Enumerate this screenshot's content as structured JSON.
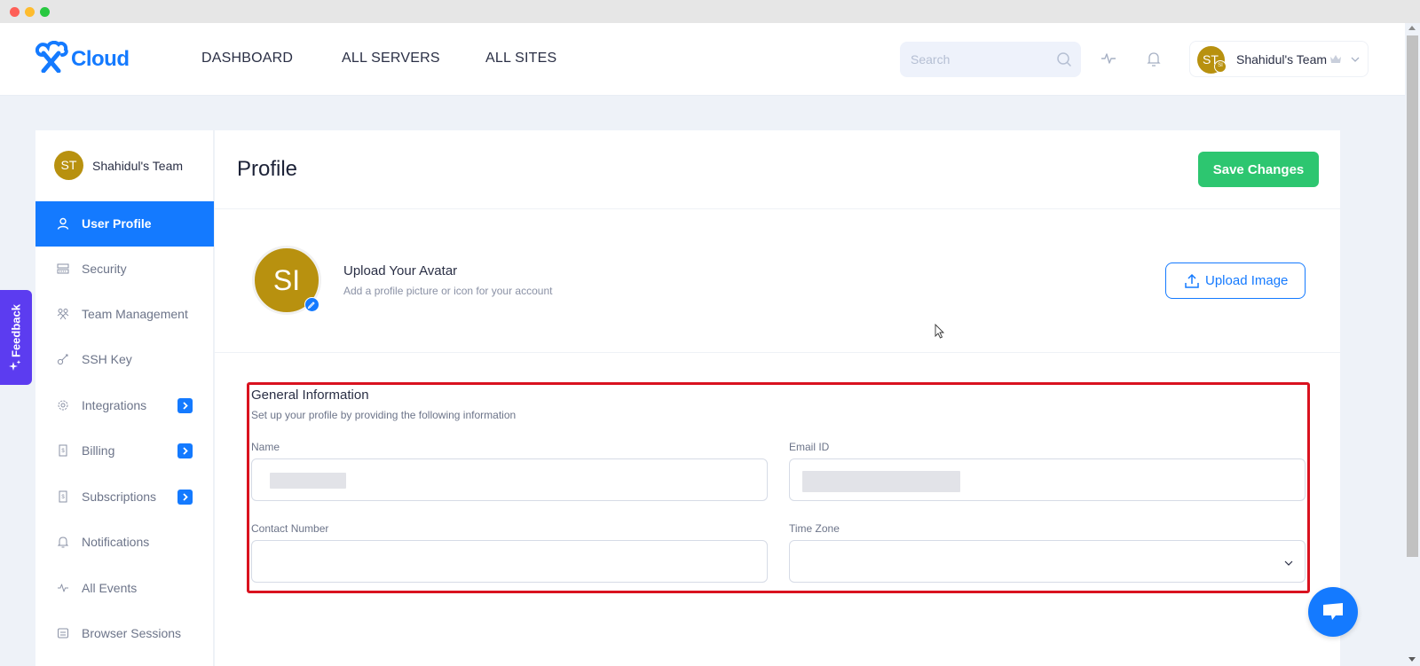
{
  "window": {
    "controls": [
      "close",
      "minimize",
      "maximize"
    ]
  },
  "header": {
    "logo_text": "Cloud",
    "nav": [
      {
        "label": "DASHBOARD"
      },
      {
        "label": "ALL SERVERS"
      },
      {
        "label": "ALL SITES"
      }
    ],
    "search": {
      "placeholder": "Search",
      "value": ""
    },
    "icons": [
      "activity-icon",
      "bell-icon"
    ],
    "team_switcher": {
      "initials": "ST",
      "mini_initials": "SI",
      "name": "Shahidul's Team"
    }
  },
  "sidebar": {
    "team": {
      "initials": "ST",
      "name": "Shahidul's Team"
    },
    "items": [
      {
        "label": "User Profile",
        "icon": "user-icon",
        "active": true,
        "has_arrow": false
      },
      {
        "label": "Security",
        "icon": "security-icon",
        "active": false,
        "has_arrow": false
      },
      {
        "label": "Team Management",
        "icon": "team-icon",
        "active": false,
        "has_arrow": false
      },
      {
        "label": "SSH Key",
        "icon": "key-icon",
        "active": false,
        "has_arrow": false
      },
      {
        "label": "Integrations",
        "icon": "gear-icon",
        "active": false,
        "has_arrow": true
      },
      {
        "label": "Billing",
        "icon": "billing-icon",
        "active": false,
        "has_arrow": true
      },
      {
        "label": "Subscriptions",
        "icon": "subscriptions-icon",
        "active": false,
        "has_arrow": true
      },
      {
        "label": "Notifications",
        "icon": "bell-icon",
        "active": false,
        "has_arrow": false
      },
      {
        "label": "All Events",
        "icon": "activity-icon",
        "active": false,
        "has_arrow": false
      },
      {
        "label": "Browser Sessions",
        "icon": "browser-sessions-icon",
        "active": false,
        "has_arrow": false
      }
    ]
  },
  "feedback": {
    "label": "Feedback"
  },
  "main": {
    "title": "Profile",
    "save_label": "Save Changes",
    "avatar": {
      "initials": "SI",
      "title": "Upload Your Avatar",
      "subtitle": "Add a profile picture or icon for your account",
      "upload_label": "Upload Image"
    },
    "general": {
      "title": "General Information",
      "subtitle": "Set up your profile by providing the following information",
      "fields": {
        "name": {
          "label": "Name",
          "value": "",
          "redacted": true
        },
        "email": {
          "label": "Email ID",
          "value": "",
          "redacted": true
        },
        "contact": {
          "label": "Contact Number",
          "value": ""
        },
        "timezone": {
          "label": "Time Zone",
          "value": ""
        }
      }
    }
  },
  "colors": {
    "brand": "#147aff",
    "save": "#2dc670",
    "avatar": "#b8910f",
    "feedback": "#5c3cf0",
    "highlight": "#d9121f"
  }
}
